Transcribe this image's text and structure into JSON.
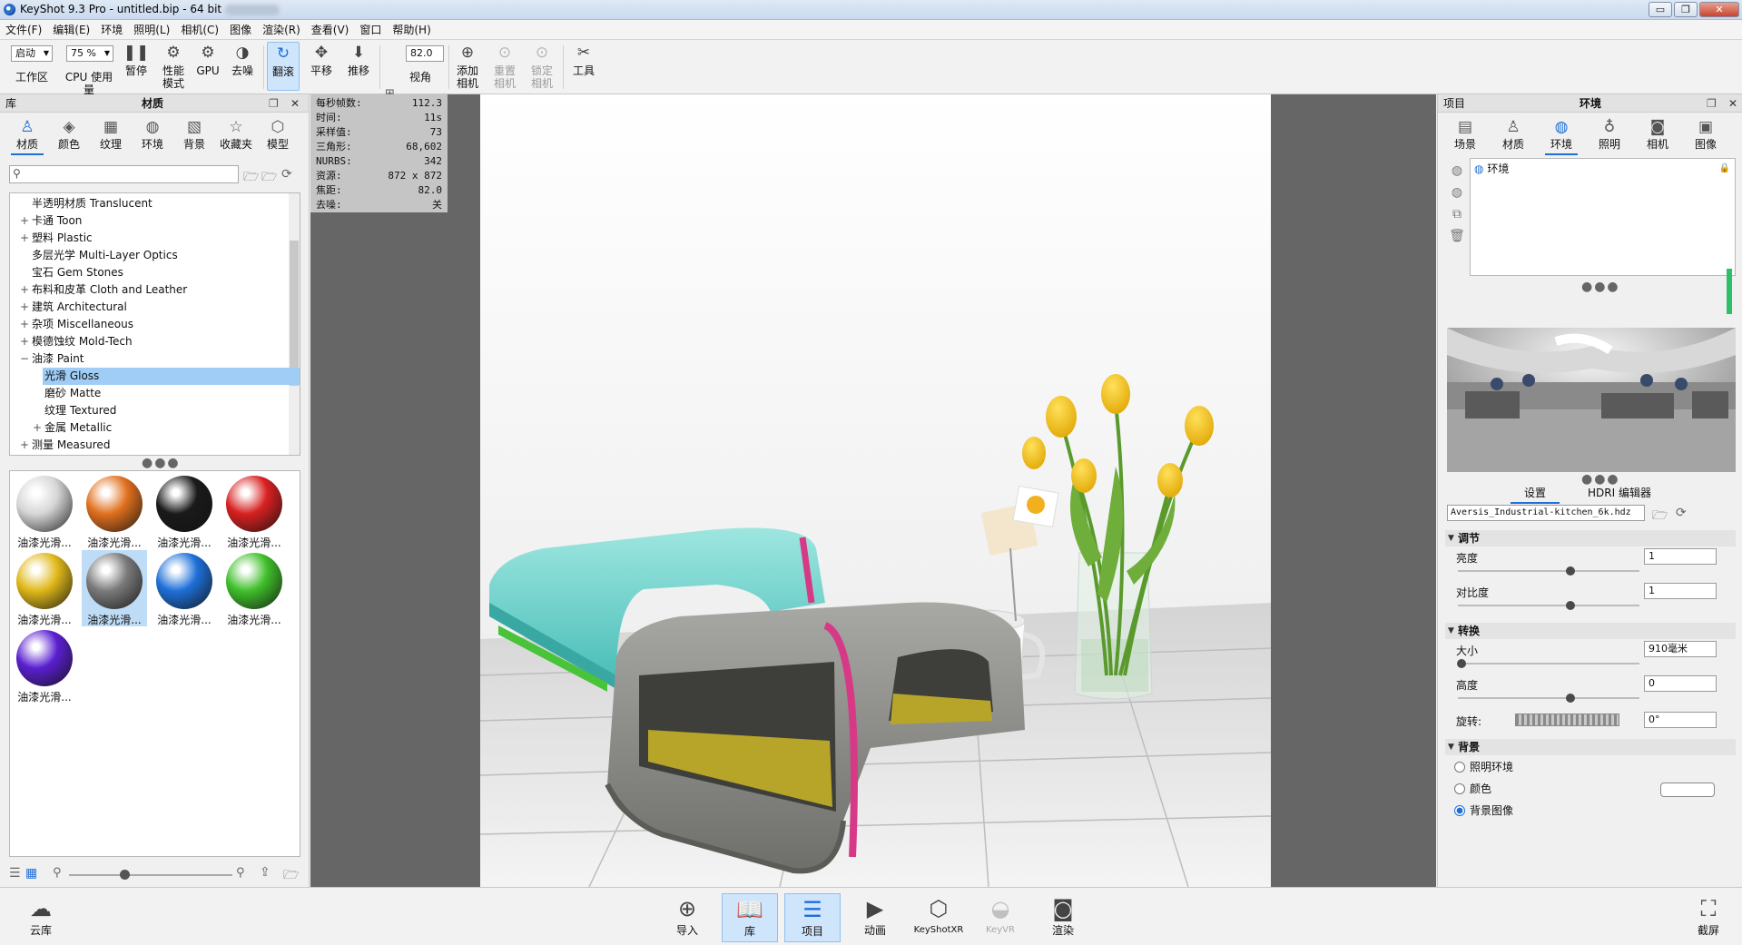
{
  "window": {
    "title": "KeyShot 9.3 Pro  - untitled.bip  - 64 bit",
    "controls": {
      "minimize": "▭",
      "restore": "❐",
      "close": "✕"
    }
  },
  "menu": [
    "文件(F)",
    "编辑(E)",
    "环境",
    "照明(L)",
    "相机(C)",
    "图像",
    "渲染(R)",
    "查看(V)",
    "窗口",
    "帮助(H)"
  ],
  "toolbar": {
    "workspace_select": "启动",
    "workspace_label": "工作区",
    "cpu_select": "75 %",
    "cpu_label": "CPU 使用量",
    "pause": "暂停",
    "perf_mode": "性能\n模式",
    "gpu": "GPU",
    "denoise": "去噪",
    "tumble": "翻滚",
    "pan": "平移",
    "dolly": "推移",
    "fov_value": "82.0",
    "fov_label": "视角",
    "add_camera": "添加\n相机",
    "reset_camera": "重置\n相机",
    "lock_camera": "锁定\n相机",
    "tools": "工具"
  },
  "left_panel": {
    "header_left": "库",
    "header_title": "材质",
    "tabs": [
      {
        "label": "材质",
        "icon": "material-icon",
        "active": true
      },
      {
        "label": "颜色",
        "icon": "color-icon"
      },
      {
        "label": "纹理",
        "icon": "texture-icon"
      },
      {
        "label": "环境",
        "icon": "environment-icon"
      },
      {
        "label": "背景",
        "icon": "background-icon"
      },
      {
        "label": "收藏夹",
        "icon": "favorites-icon"
      },
      {
        "label": "模型",
        "icon": "model-icon"
      }
    ],
    "search_placeholder": "",
    "tree": [
      {
        "pm": "",
        "indent": 0,
        "label": "半透明材质 Translucent"
      },
      {
        "pm": "+",
        "indent": 0,
        "label": "卡通 Toon"
      },
      {
        "pm": "+",
        "indent": 0,
        "label": "塑料 Plastic"
      },
      {
        "pm": "",
        "indent": 0,
        "label": "多层光学 Multi-Layer Optics"
      },
      {
        "pm": "",
        "indent": 0,
        "label": "宝石 Gem Stones"
      },
      {
        "pm": "+",
        "indent": 0,
        "label": "布料和皮革 Cloth and Leather"
      },
      {
        "pm": "+",
        "indent": 0,
        "label": "建筑 Architectural"
      },
      {
        "pm": "+",
        "indent": 0,
        "label": "杂项 Miscellaneous"
      },
      {
        "pm": "+",
        "indent": 0,
        "label": "模德蚀纹 Mold-Tech"
      },
      {
        "pm": "−",
        "indent": 0,
        "label": "油漆 Paint"
      },
      {
        "pm": "",
        "indent": 1,
        "label": "光滑 Gloss",
        "selected": true
      },
      {
        "pm": "",
        "indent": 1,
        "label": "磨砂 Matte"
      },
      {
        "pm": "",
        "indent": 1,
        "label": "纹理 Textured"
      },
      {
        "pm": "+",
        "indent": 1,
        "label": "金属 Metallic"
      },
      {
        "pm": "+",
        "indent": 0,
        "label": "测量 Measured"
      }
    ],
    "thumbnails": [
      {
        "label": "油漆光滑...",
        "color": "#d6d6d6"
      },
      {
        "label": "油漆光滑...",
        "color": "#e0701e"
      },
      {
        "label": "油漆光滑...",
        "color": "#1a1a1a"
      },
      {
        "label": "油漆光滑...",
        "color": "#d82020"
      },
      {
        "label": "油漆光滑...",
        "color": "#e0b81a"
      },
      {
        "label": "油漆光滑...",
        "color": "#7a7a7a",
        "selected": true
      },
      {
        "label": "油漆光滑...",
        "color": "#1e6fd8"
      },
      {
        "label": "油漆光滑...",
        "color": "#3fbf2a"
      },
      {
        "label": "油漆光滑...",
        "color": "#5a1fd0"
      }
    ]
  },
  "stats": [
    {
      "k": "每秒帧数:",
      "v": "112.3"
    },
    {
      "k": "时间:",
      "v": "11s"
    },
    {
      "k": "采样值:",
      "v": "73"
    },
    {
      "k": "三角形:",
      "v": "68,602"
    },
    {
      "k": "NURBS:",
      "v": "342"
    },
    {
      "k": "资源:",
      "v": "872 x 872"
    },
    {
      "k": "焦距:",
      "v": "82.0"
    },
    {
      "k": "去噪:",
      "v": "关"
    }
  ],
  "right_panel": {
    "header_left": "项目",
    "header_title": "环境",
    "tabs": [
      {
        "label": "场景",
        "icon": "scene-icon"
      },
      {
        "label": "材质",
        "icon": "material-icon"
      },
      {
        "label": "环境",
        "icon": "environment-icon",
        "active": true
      },
      {
        "label": "照明",
        "icon": "lighting-icon"
      },
      {
        "label": "相机",
        "icon": "camera-icon"
      },
      {
        "label": "图像",
        "icon": "image-icon"
      }
    ],
    "env_item": "环境",
    "subtabs": [
      "设置",
      "HDRI 编辑器"
    ],
    "hdri_file": "Aversis_Industrial-kitchen_6k.hdz",
    "sections": {
      "adjust": "调节",
      "brightness_label": "亮度",
      "brightness_value": "1",
      "brightness_level": 0.62,
      "contrast_label": "对比度",
      "contrast_value": "1",
      "contrast_level": 0.62,
      "transform": "转换",
      "size_label": "大小",
      "size_value": "910毫米",
      "size_level": 0.02,
      "height_label": "高度",
      "height_value": "0",
      "height_level": 0.62,
      "rotation_label": "旋转:",
      "rotation_value": "0°",
      "background": "背景",
      "bg_opt1": "照明环境",
      "bg_opt2": "颜色",
      "bg_opt3": "背景图像"
    }
  },
  "bottom": {
    "cloud": "云库",
    "import": "导入",
    "library": "库",
    "project": "项目",
    "animation": "动画",
    "keyshotxr": "KeyShotXR",
    "keyvr": "KeyVR",
    "render": "渲染",
    "screenshot": "截屏"
  },
  "colors": {
    "accent": "#1f6fd6",
    "selected_row": "#9fcdf5",
    "model_teal": "#6fd3cf",
    "model_gray": "#8a8a85",
    "stripe": "#d63a86"
  }
}
